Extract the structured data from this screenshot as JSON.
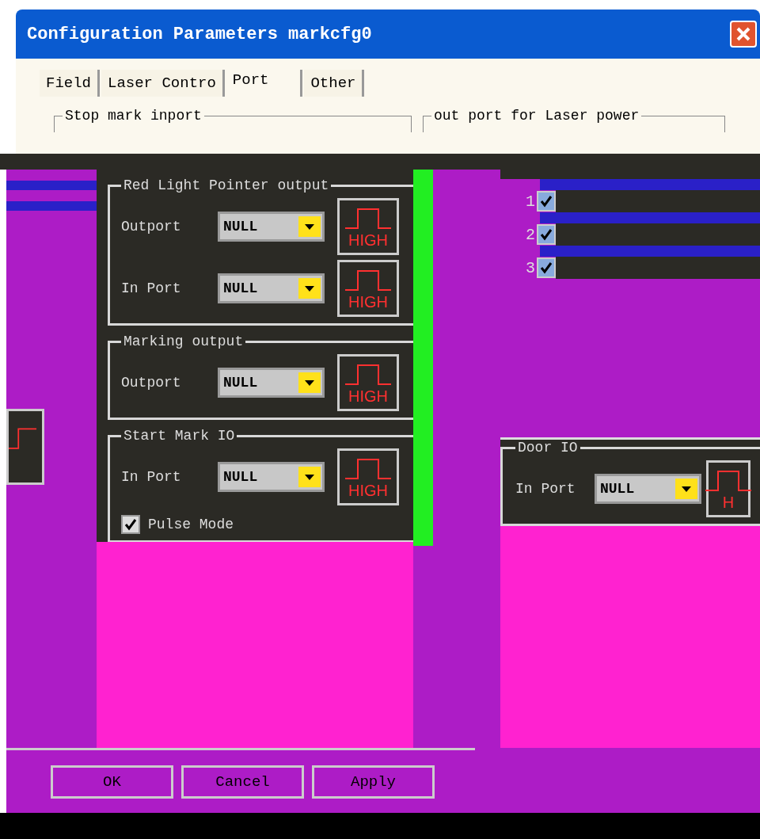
{
  "window": {
    "title": "Configuration Parameters markcfg0"
  },
  "tabs": [
    {
      "label": "Field",
      "selected": false
    },
    {
      "label": "Laser Contro",
      "selected": false
    },
    {
      "label": "Port",
      "selected": true
    },
    {
      "label": "Other",
      "selected": false
    }
  ],
  "top_groups": [
    {
      "title": "Stop mark inport"
    },
    {
      "title": "out port for Laser power"
    }
  ],
  "groups": [
    {
      "title": "Red Light Pointer output",
      "rows": [
        {
          "kind": "port",
          "label": "Outport",
          "value": "NULL",
          "level_button": "HIGH"
        },
        {
          "kind": "port",
          "label": "In Port",
          "value": "NULL",
          "level_button": "HIGH"
        }
      ]
    },
    {
      "title": "Marking output",
      "rows": [
        {
          "kind": "port",
          "label": "Outport",
          "value": "NULL",
          "level_button": "HIGH"
        }
      ]
    },
    {
      "title": "Start Mark IO",
      "rows": [
        {
          "kind": "port",
          "label": "In Port",
          "value": "NULL",
          "level_button": "HIGH"
        },
        {
          "kind": "checkbox",
          "label": "Pulse Mode",
          "checked": true
        }
      ]
    }
  ],
  "channels": [
    {
      "number": "1",
      "checked": true
    },
    {
      "number": "2",
      "checked": true
    },
    {
      "number": "3",
      "checked": true
    }
  ],
  "door_group": {
    "title": "Door IO",
    "rows": [
      {
        "kind": "port",
        "label": "In Port",
        "value": "NULL",
        "level_button": "H"
      }
    ]
  },
  "buttons": [
    {
      "label": "OK"
    },
    {
      "label": "Cancel"
    },
    {
      "label": "Apply"
    }
  ]
}
